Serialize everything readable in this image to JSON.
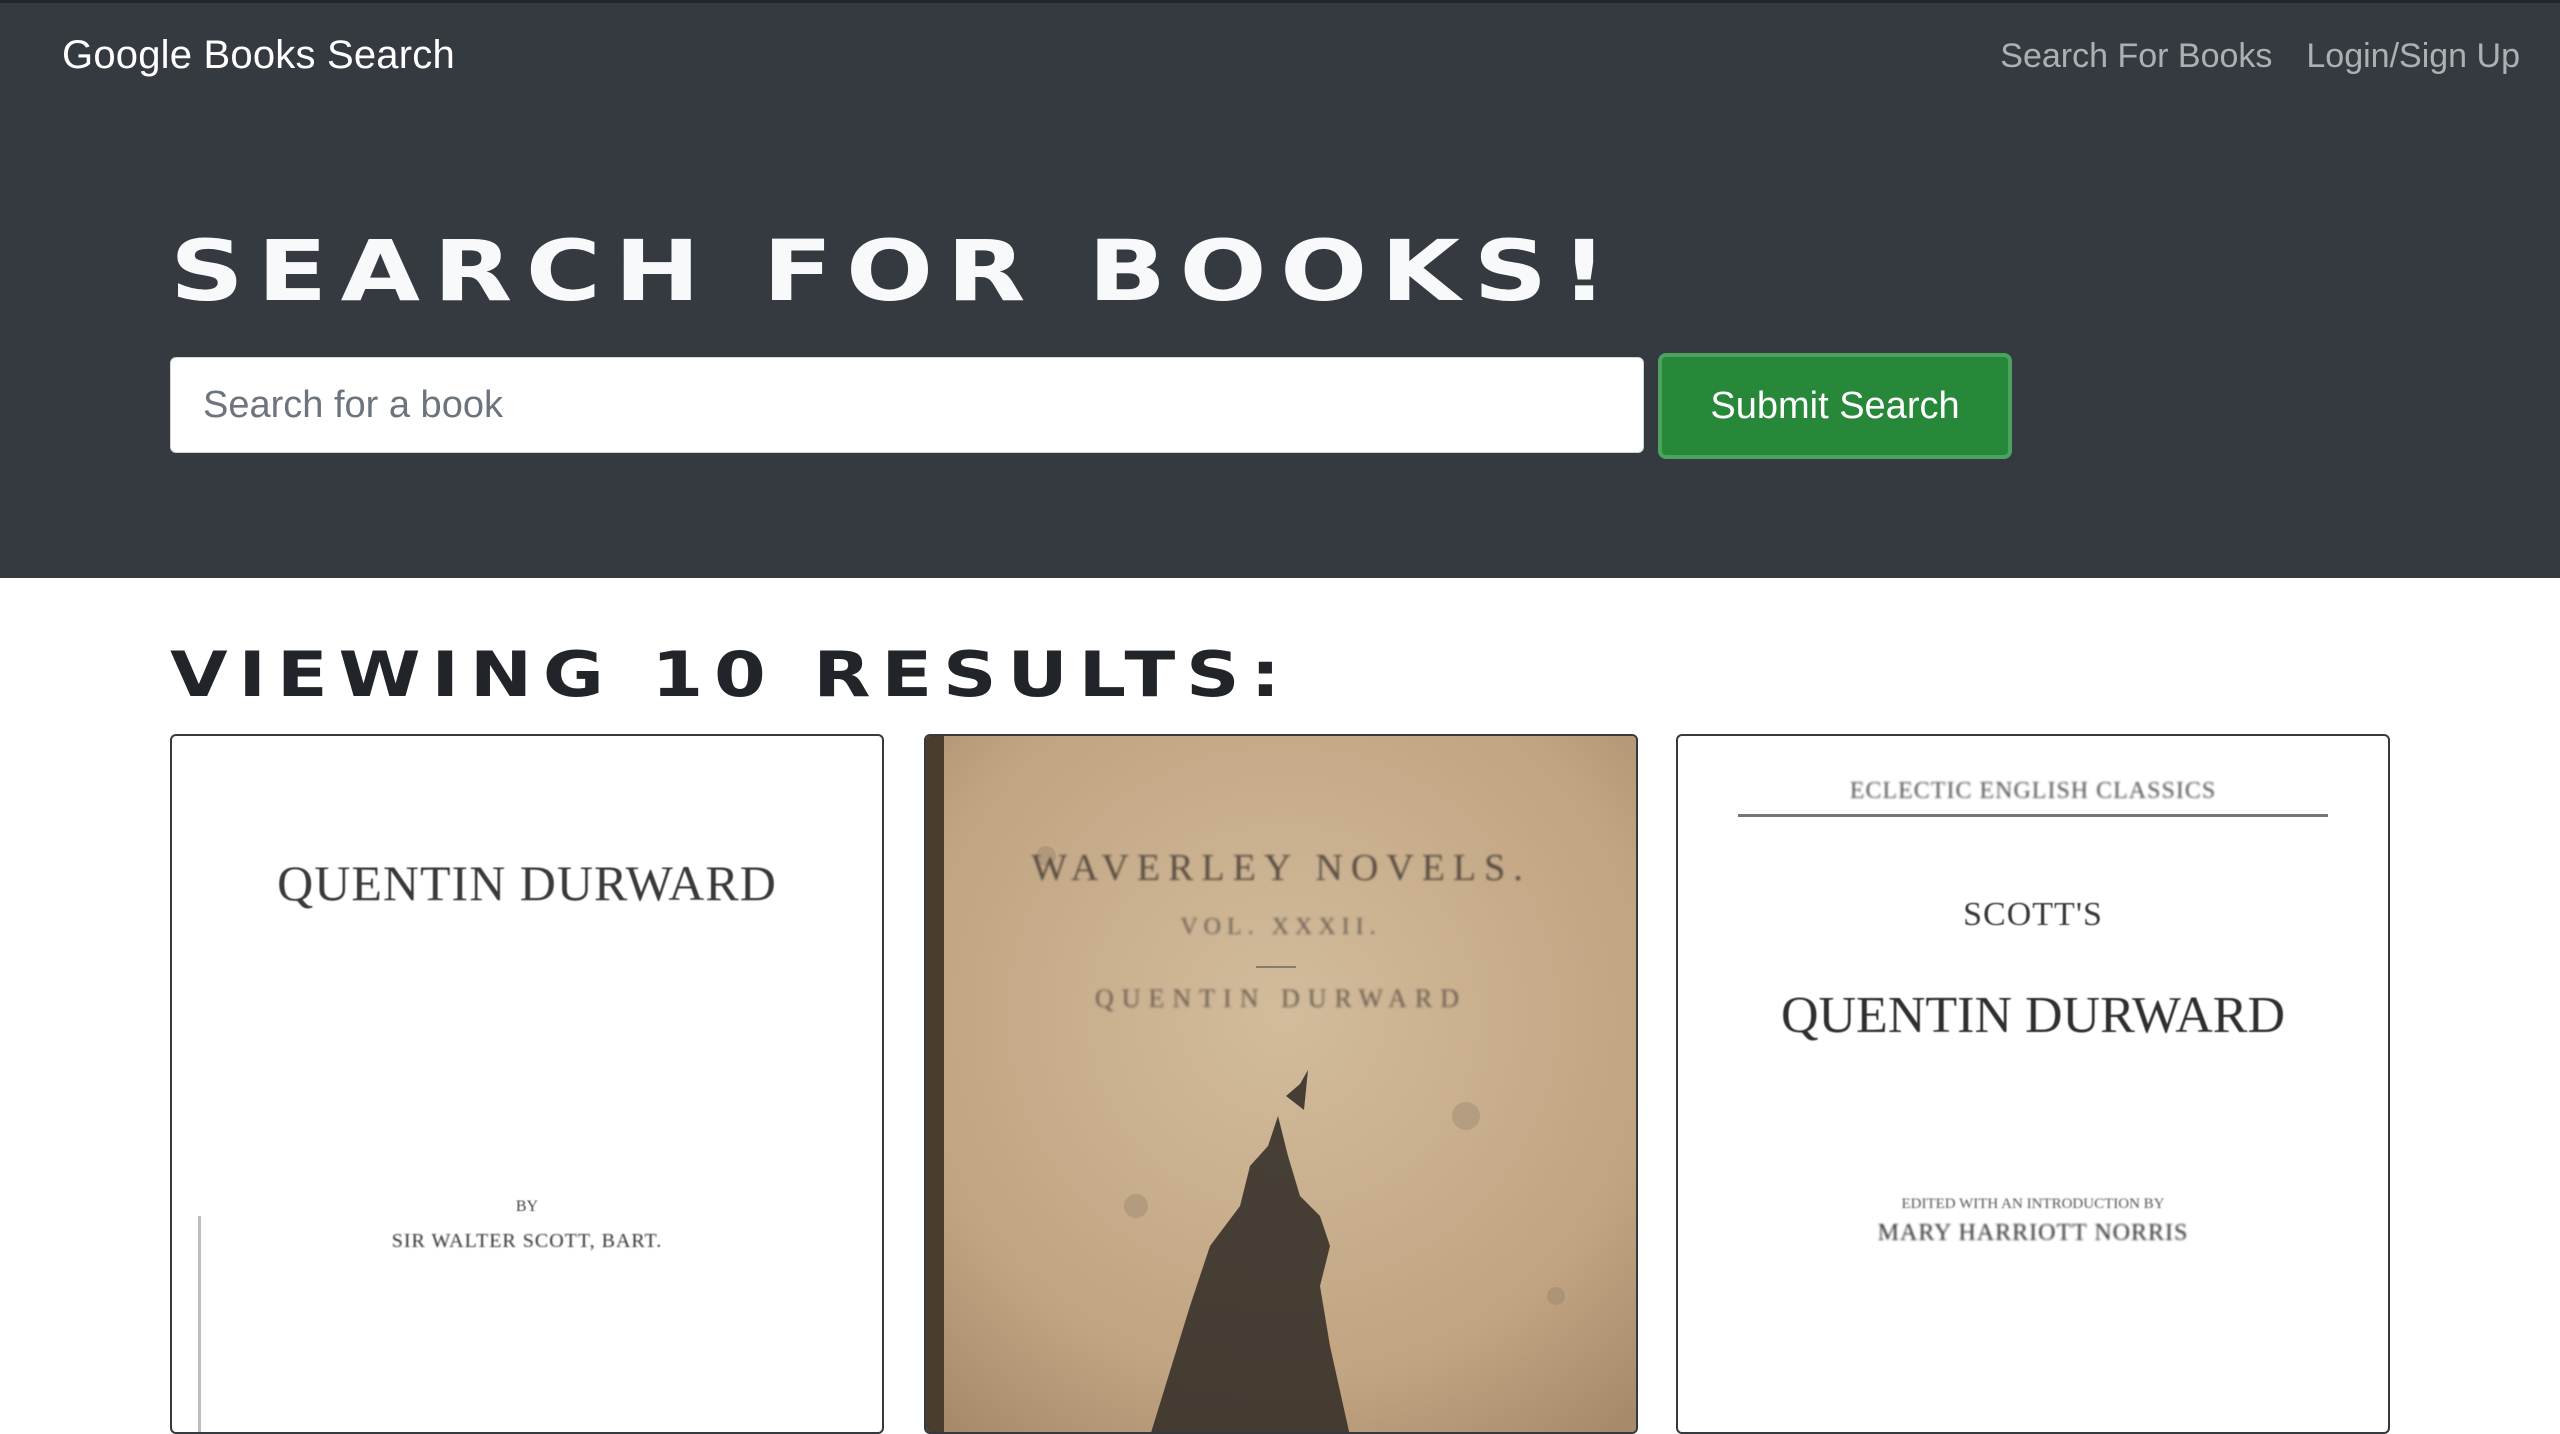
{
  "navbar": {
    "brand": "Google Books Search",
    "links": [
      "Search For Books",
      "Login/Sign Up"
    ]
  },
  "hero": {
    "title": "Search for Books!",
    "search_placeholder": "Search for a book",
    "search_value": "",
    "submit_label": "Submit Search"
  },
  "results": {
    "heading": "Viewing 10 results:",
    "cards": [
      {
        "cover_title": "QUENTIN DURWARD",
        "cover_by": "BY",
        "cover_author": "SIR WALTER SCOTT, BART."
      },
      {
        "cover_series": "WAVERLEY NOVELS.",
        "cover_volume": "VOL. XXXII.",
        "cover_title": "QUENTIN DURWARD"
      },
      {
        "cover_series": "ECLECTIC ENGLISH CLASSICS",
        "cover_subtitle": "SCOTT'S",
        "cover_title": "QUENTIN DURWARD",
        "cover_line1": "EDITED WITH AN INTRODUCTION BY",
        "cover_line2": "MARY HARRIOTT NORRIS"
      }
    ]
  }
}
